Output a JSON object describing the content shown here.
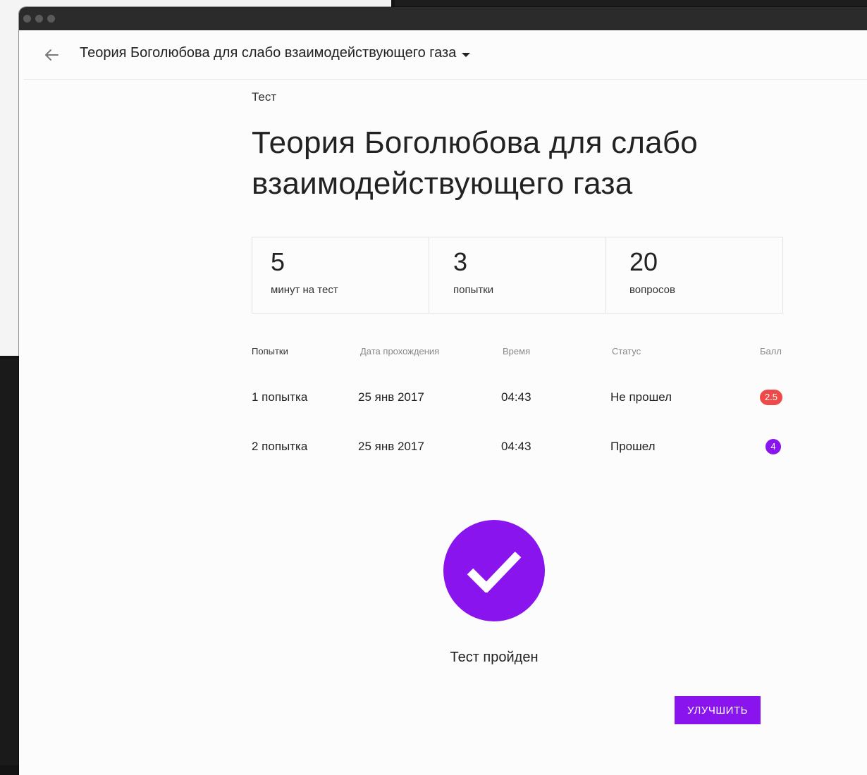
{
  "header": {
    "title": "Теория Боголюбова для слабо взаимодействующего газа"
  },
  "page": {
    "kicker": "Тест",
    "title_line1": "Теория Боголюбова для слабо",
    "title_line2": "взаимодействующего газа"
  },
  "stats": [
    {
      "value": "5",
      "label": "минут на тест"
    },
    {
      "value": "3",
      "label": "попытки"
    },
    {
      "value": "20",
      "label": "вопросов"
    }
  ],
  "table": {
    "headers": [
      "Попытки",
      "Дата прохождения",
      "Время",
      "Статус",
      "Балл"
    ],
    "rows": [
      {
        "attempt": "1 попытка",
        "date": "25 янв 2017",
        "time": "04:43",
        "status": "Не прошел",
        "score": "2.5",
        "score_state": "fail"
      },
      {
        "attempt": "2 попытка",
        "date": "25 янв 2017",
        "time": "04:43",
        "status": "Прошел",
        "score": "4",
        "score_state": "pass"
      }
    ]
  },
  "result": {
    "text": "Тест пройден"
  },
  "actions": {
    "improve_label": "Улучшить"
  },
  "colors": {
    "accent": "#8a14ee",
    "fail": "#ef4a4a"
  },
  "icons": {
    "back": "arrow-left-icon",
    "dropdown": "caret-down-icon",
    "result": "checkmark-icon"
  }
}
